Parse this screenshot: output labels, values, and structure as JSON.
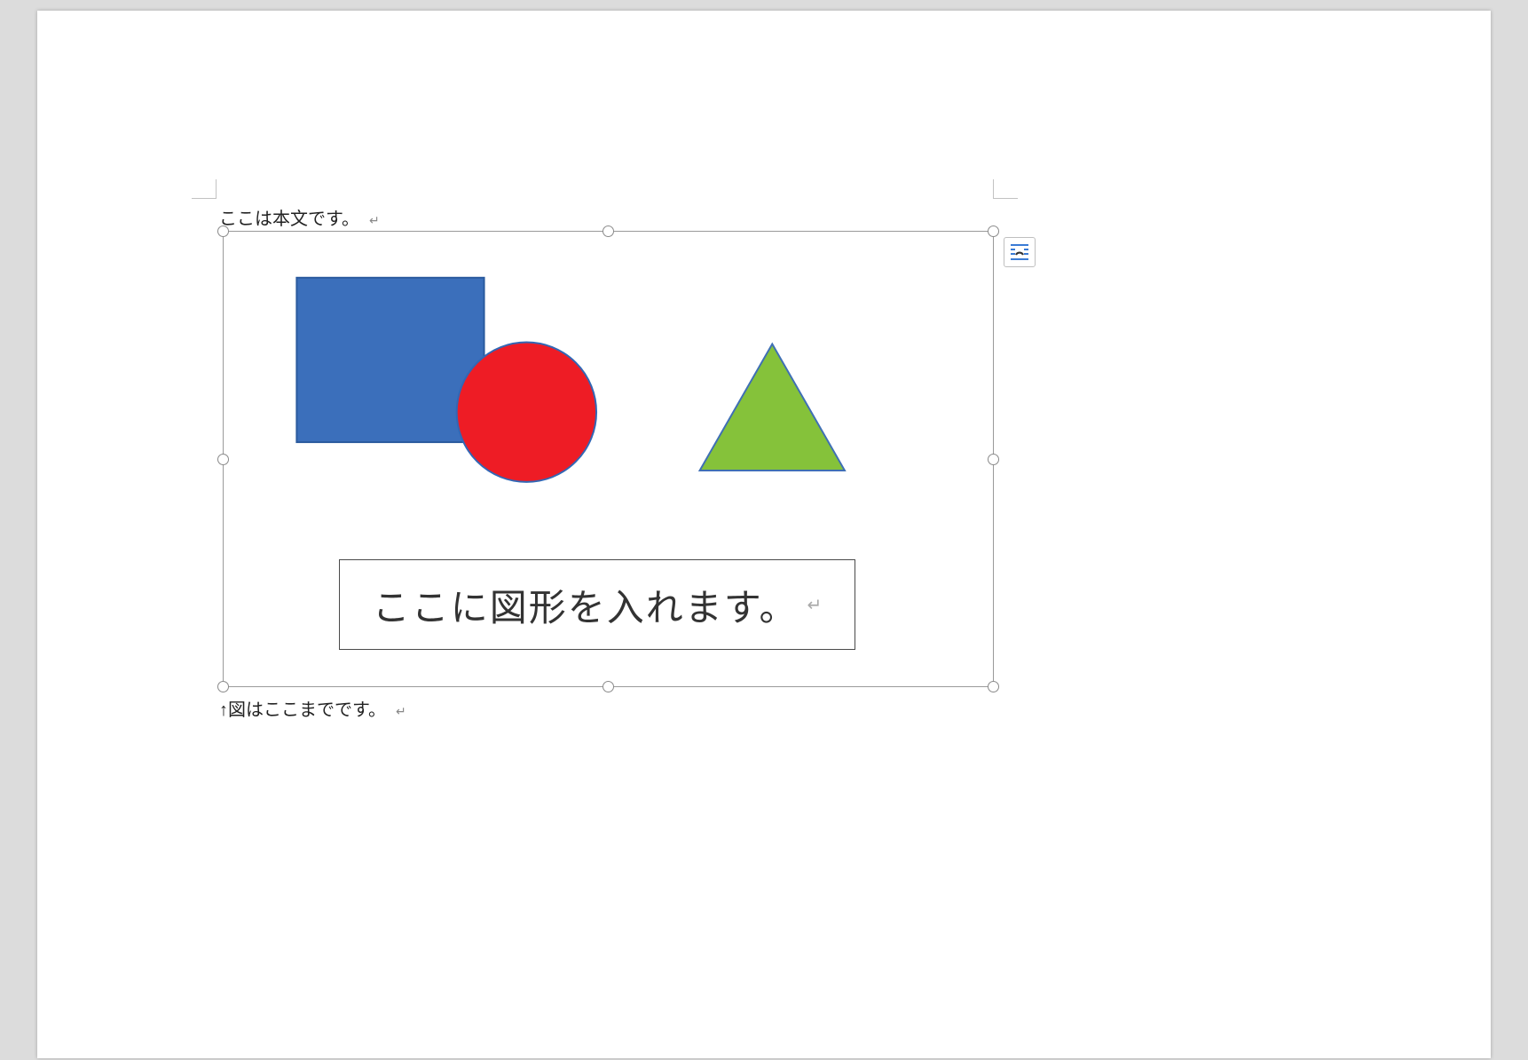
{
  "document": {
    "body_text_before": "ここは本文です。",
    "body_text_after": "↑図はここまでです。",
    "paragraph_mark": "↵"
  },
  "canvas": {
    "textbox_label": "ここに図形を入れます。",
    "shapes": {
      "rectangle": {
        "fill": "#3b6fbb",
        "stroke": "#2a5a9e"
      },
      "circle": {
        "fill": "#ee1c25",
        "stroke": "#3267b5"
      },
      "triangle": {
        "fill": "#85c23a",
        "stroke": "#3f6fb5"
      }
    }
  },
  "controls": {
    "layout_options_tooltip": "レイアウト オプション"
  },
  "colors": {
    "page_bg": "#ffffff",
    "app_bg": "#dcdcdc",
    "handle_border": "#8a8a8a"
  }
}
